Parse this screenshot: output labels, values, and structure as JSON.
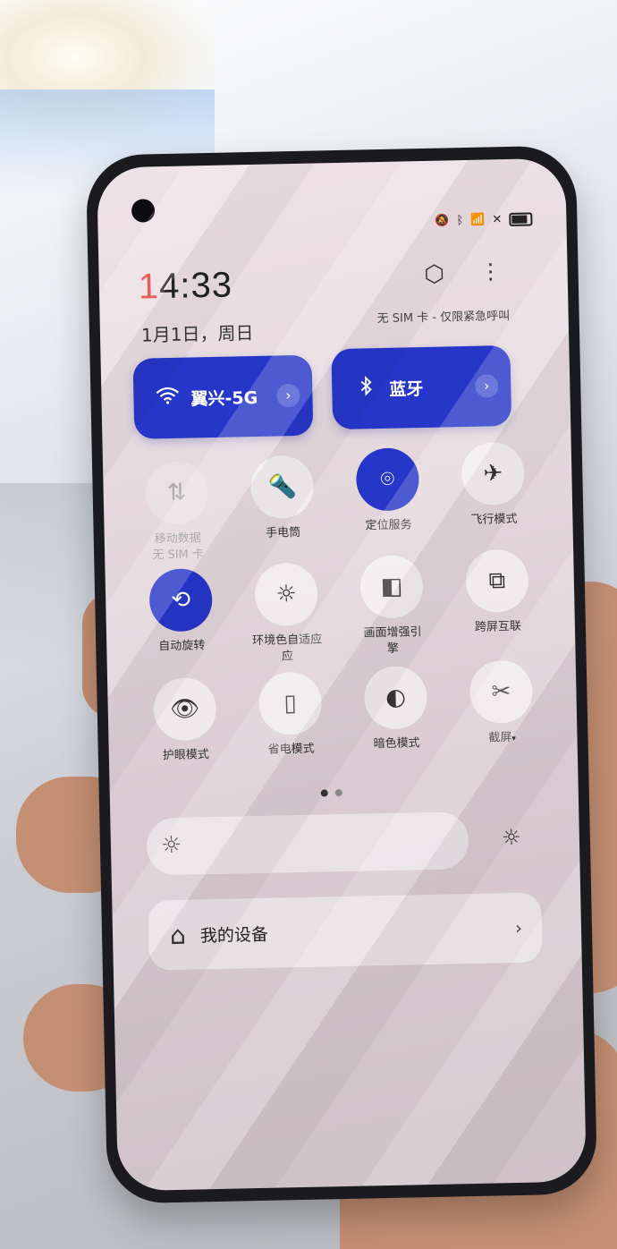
{
  "status_bar": {
    "icons": [
      "mute-icon",
      "bluetooth-icon",
      "wifi-icon",
      "no-sim-icon",
      "battery-icon"
    ]
  },
  "header": {
    "clock_first": "1",
    "clock_rest": "4:33",
    "date": "1月1日，周日",
    "sim_status": "无 SIM 卡 - 仅限紧急呼叫"
  },
  "big_tiles": {
    "wifi": {
      "label": "翼兴-5G",
      "icon": "wifi-icon",
      "chevron": "›"
    },
    "bluetooth": {
      "label": "蓝牙",
      "icon": "bluetooth-icon",
      "chevron": "›"
    }
  },
  "tiles": [
    {
      "label": "移动数据",
      "sub": "无 SIM 卡",
      "icon": "mobile-data-icon",
      "state": "off"
    },
    {
      "label": "手电筒",
      "icon": "flashlight-icon",
      "state": "inactive"
    },
    {
      "label": "定位服务",
      "icon": "location-icon",
      "state": "active"
    },
    {
      "label": "飞行模式",
      "icon": "airplane-icon",
      "state": "inactive"
    },
    {
      "label": "自动旋转",
      "icon": "auto-rotate-icon",
      "state": "active"
    },
    {
      "label": "环境色自适应",
      "sub": "应",
      "icon": "ambient-color-icon",
      "state": "inactive"
    },
    {
      "label": "画面增强引",
      "sub": "擎",
      "icon": "display-enhance-icon",
      "state": "inactive"
    },
    {
      "label": "跨屏互联",
      "icon": "screen-cast-icon",
      "state": "inactive"
    },
    {
      "label": "护眼模式",
      "icon": "eye-icon",
      "state": "inactive"
    },
    {
      "label": "省电模式",
      "icon": "battery-saver-icon",
      "state": "inactive"
    },
    {
      "label": "暗色模式",
      "icon": "dark-mode-icon",
      "state": "inactive"
    },
    {
      "label": "截屏",
      "sub_marker": "▾",
      "icon": "screenshot-icon",
      "state": "inactive"
    }
  ],
  "pager": {
    "pages": 2,
    "current": 1
  },
  "my_devices": {
    "label": "我的设备",
    "chevron": "›"
  },
  "colors": {
    "accent": "#2636c8",
    "clock_red": "#e23a3a"
  }
}
